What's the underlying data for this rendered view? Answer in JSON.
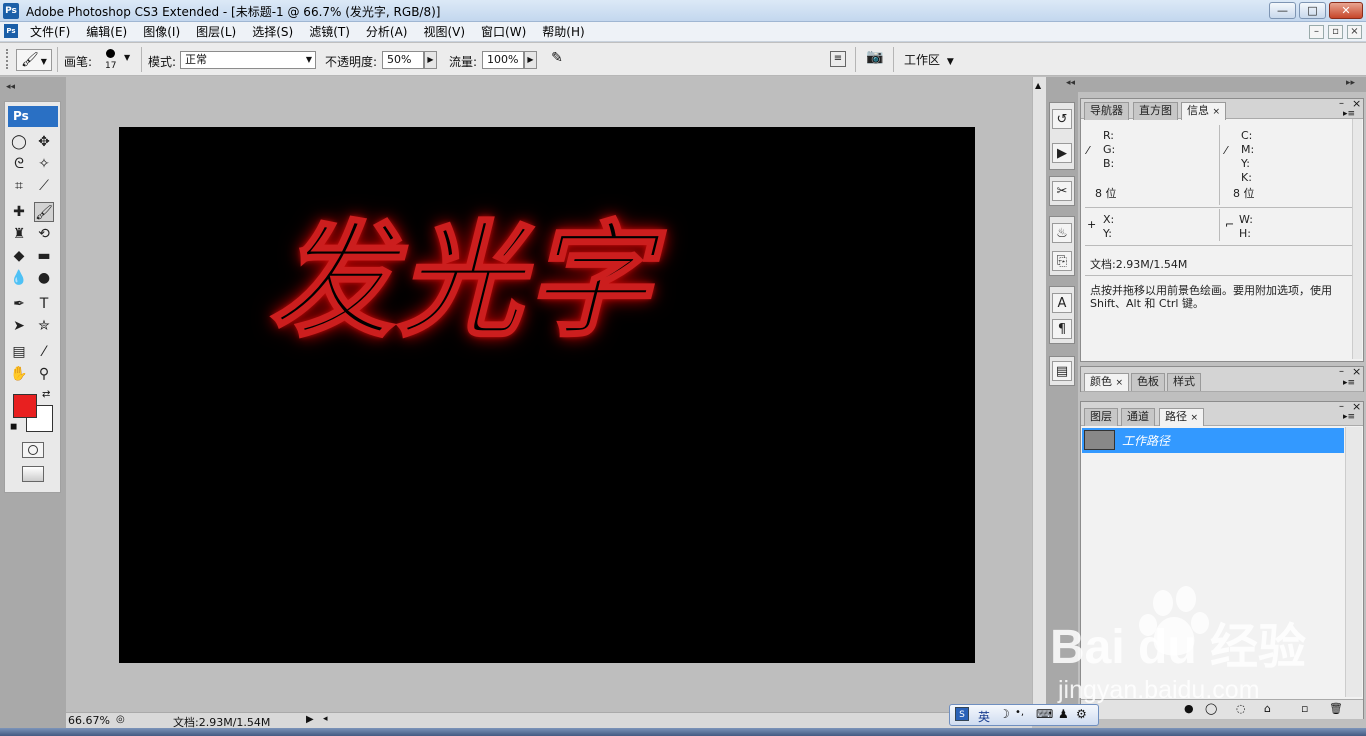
{
  "window": {
    "app_logo": "Ps",
    "title": "Adobe Photoshop CS3 Extended - [未标题-1 @ 66.7% (发光字, RGB/8)]",
    "controls": [
      "—",
      "□",
      "✕"
    ],
    "doc_controls": [
      "–",
      "▫",
      "×"
    ]
  },
  "menu": [
    "文件(F)",
    "编辑(E)",
    "图像(I)",
    "图层(L)",
    "选择(S)",
    "滤镜(T)",
    "分析(A)",
    "视图(V)",
    "窗口(W)",
    "帮助(H)"
  ],
  "options": {
    "brush_label": "画笔:",
    "brush_size": "17",
    "mode_label": "模式:",
    "mode_value": "正常",
    "opacity_label": "不透明度:",
    "opacity_value": "50%",
    "flow_label": "流量:",
    "flow_value": "100%",
    "workspace_label": "工作区"
  },
  "toolbox": {
    "logo": "Ps",
    "fg_color": "#e82020",
    "bg_color": "#ffffff"
  },
  "canvas": {
    "text": "发光字",
    "glow_color": "#cc1e1e"
  },
  "status": {
    "zoom": "66.67%",
    "doc_info": "文档:2.93M/1.54M"
  },
  "info_panel": {
    "tabs": [
      "导航器",
      "直方图",
      "信息"
    ],
    "rgb_labels": [
      "R:",
      "G:",
      "B:"
    ],
    "cmyk_labels": [
      "C:",
      "M:",
      "Y:",
      "K:"
    ],
    "bits_left": "8 位",
    "bits_right": "8 位",
    "x_label": "X:",
    "y_label": "Y:",
    "w_label": "W:",
    "h_label": "H:",
    "doc": "文档:2.93M/1.54M",
    "hint": "点按并拖移以用前景色绘画。要用附加选项，使用 Shift、Alt 和 Ctrl 键。"
  },
  "color_panel": {
    "tabs": [
      "颜色",
      "色板",
      "样式"
    ]
  },
  "layers_panel": {
    "tabs": [
      "图层",
      "通道",
      "路径"
    ],
    "path_name": "工作路径"
  },
  "ime": {
    "lang": "英"
  },
  "watermark": {
    "brand": "Bai du 经验",
    "url": "jingyan.baidu.com"
  }
}
